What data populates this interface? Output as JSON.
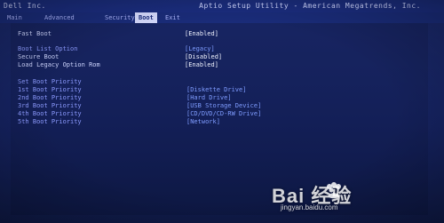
{
  "header": {
    "vendor": "Dell Inc.",
    "utility": "Aptio Setup Utility - American Megatrends, Inc."
  },
  "tabs": [
    {
      "label": "Main"
    },
    {
      "label": "Advanced"
    },
    {
      "label": "Security"
    },
    {
      "label": "Boot"
    },
    {
      "label": "Exit"
    }
  ],
  "boot": {
    "items": [
      {
        "label": "Fast Boot",
        "value": "[Enabled]"
      },
      {
        "label": "Boot List Option",
        "value": "[Legacy]"
      },
      {
        "label": "Secure Boot",
        "value": "[Disabled]"
      },
      {
        "label": "Load Legacy Option Rom",
        "value": "[Enabled]"
      },
      {
        "label": "Set Boot Priority",
        "value": ""
      },
      {
        "label": "1st Boot Priority",
        "value": "[Diskette Drive]"
      },
      {
        "label": "2nd Boot Priority",
        "value": "[Hard Drive]"
      },
      {
        "label": "3rd Boot Priority",
        "value": "[USB Storage Device]"
      },
      {
        "label": "4th Boot Priority",
        "value": "[CD/DVD/CD-RW Drive]"
      },
      {
        "label": "5th Boot Priority",
        "value": "[Network]"
      }
    ]
  },
  "watermark": {
    "brand": "Bai  经验",
    "url": "jingyan.baidu.com",
    "icon": "baidu-paw-icon"
  },
  "colors": {
    "bg": "#15225f",
    "header": "#1a2c7a",
    "text": "#cfd6ff",
    "value": "#f1f4ff",
    "value_blue": "#7f9cff",
    "active_tab_bg": "#d7dcff",
    "active_tab_fg": "#1b2d7c"
  }
}
